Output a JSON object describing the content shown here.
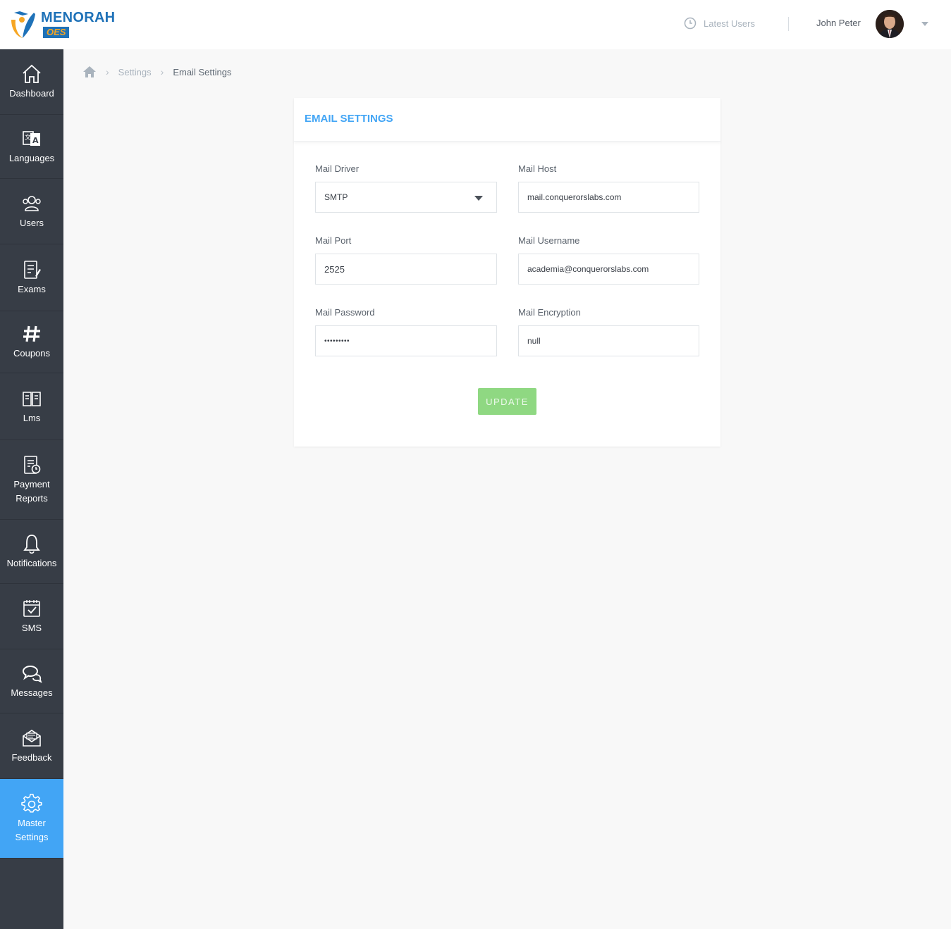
{
  "brand": {
    "name": "MENORAH",
    "badge": "OES"
  },
  "header": {
    "latest_users": "Latest Users",
    "user_name": "John Peter"
  },
  "sidebar": {
    "items": [
      {
        "label": "Dashboard",
        "icon": "home-icon"
      },
      {
        "label": "Languages",
        "icon": "translate-icon"
      },
      {
        "label": "Users",
        "icon": "users-icon"
      },
      {
        "label": "Exams",
        "icon": "exams-icon"
      },
      {
        "label": "Coupons",
        "icon": "hash-icon"
      },
      {
        "label": "Lms",
        "icon": "book-icon"
      },
      {
        "label": "Payment Reports",
        "icon": "report-icon"
      },
      {
        "label": "Notifications",
        "icon": "bell-icon"
      },
      {
        "label": "SMS",
        "icon": "calendar-check-icon"
      },
      {
        "label": "Messages",
        "icon": "chat-icon"
      },
      {
        "label": "Feedback",
        "icon": "envelope-icon"
      },
      {
        "label": "Master Settings",
        "icon": "gear-icon",
        "active": true
      }
    ]
  },
  "breadcrumb": {
    "parent": "Settings",
    "current": "Email Settings"
  },
  "form": {
    "title": "EMAIL SETTINGS",
    "mail_driver": {
      "label": "Mail Driver",
      "value": "SMTP"
    },
    "mail_host": {
      "label": "Mail Host",
      "value": "mail.conquerorslabs.com"
    },
    "mail_port": {
      "label": "Mail Port",
      "value": "2525"
    },
    "mail_username": {
      "label": "Mail Username",
      "value": "academia@conquerorslabs.com"
    },
    "mail_password": {
      "label": "Mail Password",
      "value": "•••••••••"
    },
    "mail_encryption": {
      "label": "Mail Encryption",
      "value": "null"
    },
    "update_label": "UPDATE"
  },
  "colors": {
    "sidebar_bg": "#373d46",
    "active_item": "#42a5f5",
    "title_blue": "#42a5f5",
    "update_button": "#8fd882",
    "brand_blue": "#1f72b8",
    "brand_orange": "#f6a623"
  }
}
